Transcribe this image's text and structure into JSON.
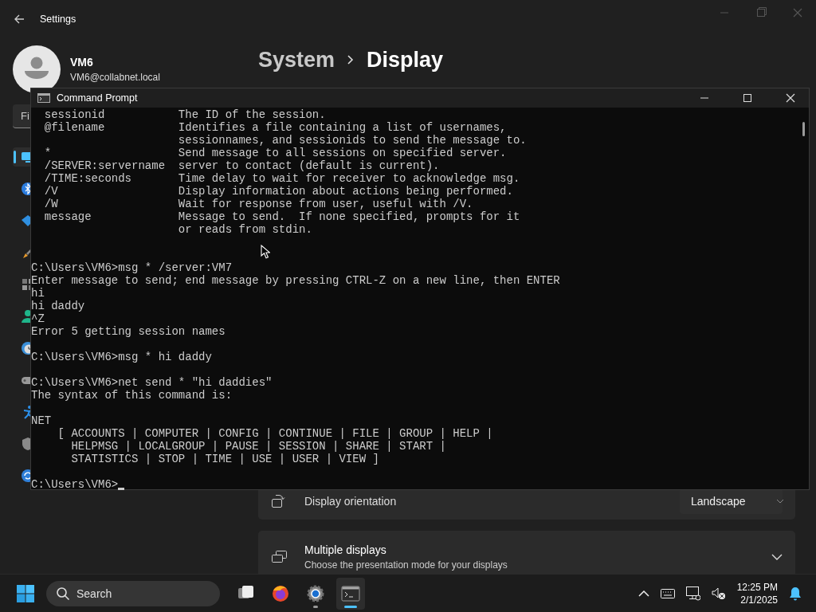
{
  "settings": {
    "title": "Settings",
    "user": {
      "name": "VM6",
      "email": "VM6@collabnet.local"
    },
    "search": {
      "placeholder": "Fi"
    },
    "sidebar": {
      "items": [
        {
          "selected": true
        },
        {
          "selected": false
        },
        {
          "selected": false
        },
        {
          "selected": false
        },
        {
          "selected": false
        },
        {
          "selected": false
        },
        {
          "selected": false
        },
        {
          "selected": false
        },
        {
          "selected": false
        },
        {
          "selected": false
        },
        {
          "selected": false
        }
      ]
    },
    "breadcrumb": [
      "System",
      "Display"
    ],
    "rows": [
      {
        "kind": "dropdown",
        "label": "Display orientation",
        "value": "Landscape"
      },
      {
        "kind": "expander",
        "label": "Multiple displays",
        "description": "Choose the presentation mode for your displays",
        "expanded": false
      }
    ]
  },
  "console": {
    "title": "Command Prompt",
    "output": [
      "  sessionid           The ID of the session.\n  @filename           Identifies a file containing a list of usernames,\n                      sessionnames, and sessionids to send the message to.\n  *                   Send message to all sessions on specified server.\n  /SERVER:servername  server to contact (default is current).\n  /TIME:seconds       Time delay to wait for receiver to acknowledge msg.\n  /V                  Display information about actions being performed.\n  /W                  Wait for response from user, useful with /V.\n  message             Message to send.  If none specified, prompts for it\n                      or reads from stdin.",
      "C:\\Users\\VM6>msg * /server:VM7\nEnter message to send; end message by pressing CTRL-Z on a new line, then ENTER\nhi\nhi daddy\n^Z\nError 5 getting session names\n\nC:\\Users\\VM6>msg * hi daddy\n\nC:\\Users\\VM6>net send * \"hi daddies\"\nThe syntax of this command is:\n\nNET\n    [ ACCOUNTS | COMPUTER | CONFIG | CONTINUE | FILE | GROUP | HELP |\n      HELPMSG | LOCALGROUP | PAUSE | SESSION | SHARE | START |\n      STATISTICS | STOP | TIME | USE | USER | VIEW ]"
    ],
    "prompt": "C:\\Users\\VM6>"
  },
  "taskbar": {
    "search": {
      "placeholder": "Search"
    },
    "apps": [
      {
        "kind": "task-view",
        "running": false,
        "selected": false
      },
      {
        "kind": "browser",
        "running": false,
        "selected": false
      },
      {
        "kind": "settings",
        "running": true,
        "selected": false
      },
      {
        "kind": "terminal",
        "running": true,
        "selected": true
      }
    ],
    "clock": {
      "time": "12:25 PM",
      "date": "2/1/2025"
    }
  }
}
